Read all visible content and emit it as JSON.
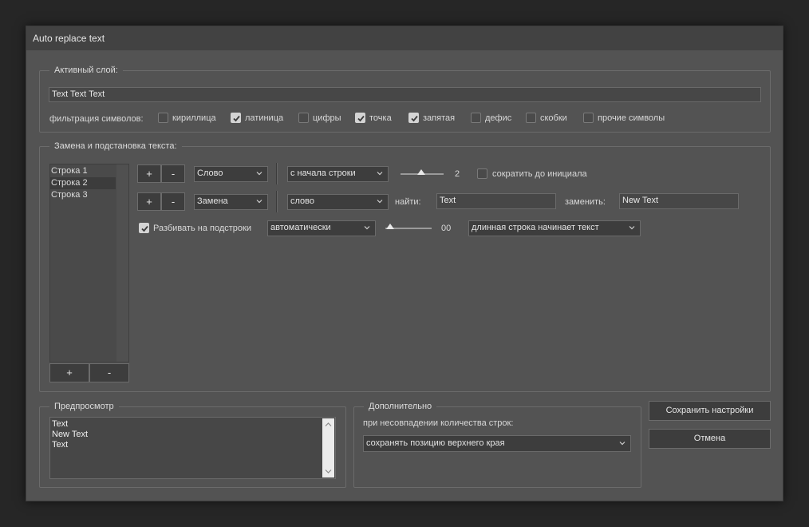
{
  "window": {
    "title": "Auto replace text"
  },
  "active_layer": {
    "legend": "Активный слой:",
    "text_value": "Text Text Text",
    "filter_label": "фильтрация символов:",
    "filters": [
      {
        "label": "кириллица",
        "checked": false
      },
      {
        "label": "латиница",
        "checked": true
      },
      {
        "label": "цифры",
        "checked": false
      },
      {
        "label": "точка",
        "checked": true
      },
      {
        "label": "запятая",
        "checked": true
      },
      {
        "label": "дефис",
        "checked": false
      },
      {
        "label": "скобки",
        "checked": false
      },
      {
        "label": "прочие символы",
        "checked": false
      }
    ]
  },
  "replace": {
    "legend": "Замена и подстановка текста:",
    "lines": [
      {
        "label": "Строка 1",
        "selected": false
      },
      {
        "label": "Строка 2",
        "selected": true
      },
      {
        "label": "Строка 3",
        "selected": false
      }
    ],
    "list_add": "+",
    "list_remove": "-",
    "row1": {
      "add": "+",
      "remove": "-",
      "mode": "Слово",
      "position": "с начала строки",
      "slider_value": "2",
      "abbrev_label": "сократить до инициала",
      "abbrev_checked": false
    },
    "row2": {
      "add": "+",
      "remove": "-",
      "mode": "Замена",
      "scope": "слово",
      "find_label": "найти:",
      "find_value": "Text",
      "replace_label": "заменить:",
      "replace_value": "New Text"
    },
    "row3": {
      "split_label": "Разбивать на подстроки",
      "split_checked": true,
      "split_mode": "автоматически",
      "slider_value": "00",
      "long_line": "длинная строка начинает текст"
    }
  },
  "preview": {
    "legend": "Предпросмотр",
    "lines": [
      "Text",
      "New Text",
      "Text"
    ]
  },
  "extra": {
    "legend": "Дополнительно",
    "mismatch_label": "при несовпадении количества строк:",
    "mismatch_value": "сохранять позицию верхнего края"
  },
  "buttons": {
    "save": "Сохранить настройки",
    "cancel": "Отмена"
  }
}
